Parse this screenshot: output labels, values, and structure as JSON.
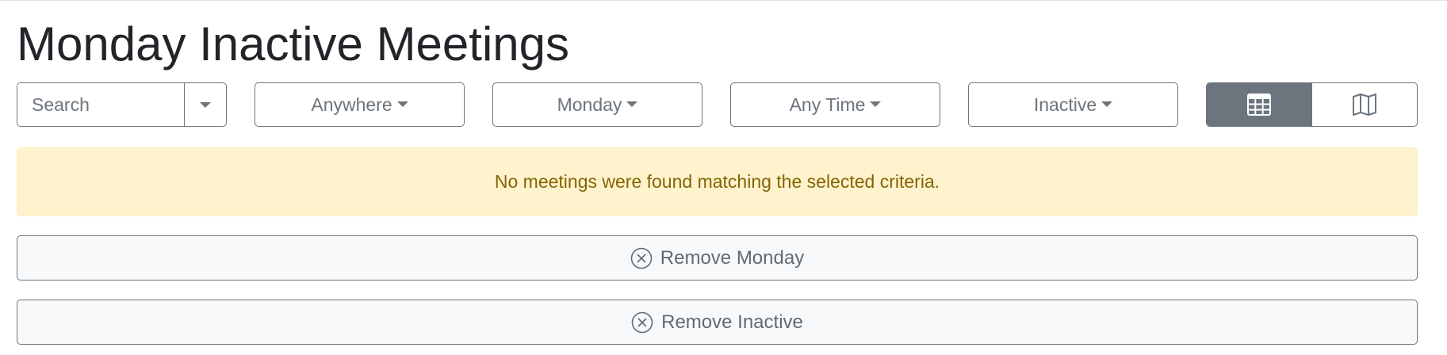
{
  "page": {
    "title": "Monday Inactive Meetings"
  },
  "controls": {
    "search": {
      "placeholder": "Search",
      "value": ""
    },
    "region": {
      "label": "Anywhere"
    },
    "day": {
      "label": "Monday"
    },
    "time": {
      "label": "Any Time"
    },
    "status": {
      "label": "Inactive"
    },
    "view_toggle": {
      "selected": "table-icon"
    }
  },
  "alert": {
    "message": "No meetings were found matching the selected criteria."
  },
  "filters": {
    "remove_day": "Remove Monday",
    "remove_status": "Remove Inactive"
  },
  "colors": {
    "alert_bg": "#fff3cd",
    "alert_text": "#856404",
    "secondary": "#6c757d"
  }
}
